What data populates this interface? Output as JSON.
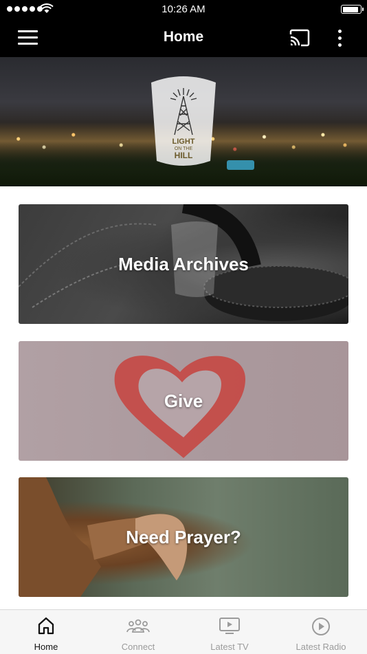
{
  "status_bar": {
    "time": "10:26 AM",
    "battery_level": 0.95
  },
  "header": {
    "title": "Home"
  },
  "hero": {
    "logo_text": [
      "LIGHT",
      "ON THE",
      "HILL"
    ]
  },
  "cards": [
    {
      "title": "Media Archives"
    },
    {
      "title": "Give"
    },
    {
      "title": "Need Prayer?"
    }
  ],
  "tabs": [
    {
      "label": "Home",
      "icon": "home-icon",
      "active": true
    },
    {
      "label": "Connect",
      "icon": "people-icon",
      "active": false
    },
    {
      "label": "Latest TV",
      "icon": "tv-icon",
      "active": false
    },
    {
      "label": "Latest Radio",
      "icon": "play-circle-icon",
      "active": false
    }
  ],
  "colors": {
    "bar_background": "#000000",
    "tab_active": "#111111",
    "tab_inactive": "#9b9b9b"
  }
}
